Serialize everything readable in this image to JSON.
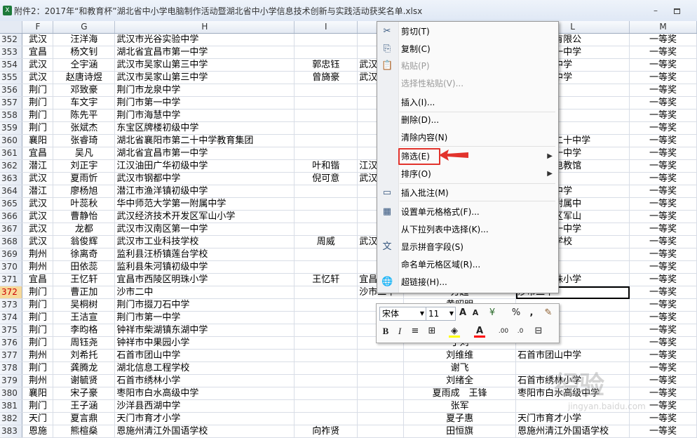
{
  "window": {
    "title": "附件2：2017年“和教育杯”湖北省中小学电脑制作活动暨湖北省中小学信息技术创新与实践活动获奖名单.xlsx",
    "app_icon": "X"
  },
  "columns": [
    "F",
    "G",
    "H",
    "I",
    "J",
    "K",
    "L",
    "M"
  ],
  "rows": [
    {
      "n": "352",
      "f": "武汉",
      "g": "汪洋海",
      "h": "武汉市光谷实验中学",
      "i": "",
      "j": "",
      "k": "",
      "l": "科技股份有限公",
      "m": "一等奖"
    },
    {
      "n": "353",
      "f": "宜昌",
      "g": "杨文钊",
      "h": "湖北省宜昌市第一中学",
      "i": "",
      "j": "",
      "k": "",
      "l": "宜昌市第一中学",
      "m": "一等奖"
    },
    {
      "n": "354",
      "f": "武汉",
      "g": "仝宇涵",
      "h": "武汉市吴家山第三中学",
      "i": "郭忠钰",
      "j": "武汉",
      "k": "",
      "l": "家山第三中学",
      "m": "一等奖"
    },
    {
      "n": "355",
      "f": "武汉",
      "g": "赵唐诗煜",
      "h": "武汉市吴家山第三中学",
      "i": "曾旖豪",
      "j": "武汉",
      "k": "",
      "l": "家山第三中学",
      "m": "一等奖"
    },
    {
      "n": "356",
      "f": "荆门",
      "g": "邓致豪",
      "h": "荆门市龙泉中学",
      "i": "",
      "j": "",
      "k": "",
      "l": "",
      "m": "一等奖"
    },
    {
      "n": "357",
      "f": "荆门",
      "g": "车文宇",
      "h": "荆门市第一中学",
      "i": "",
      "j": "",
      "k": "",
      "l": "",
      "m": "一等奖"
    },
    {
      "n": "358",
      "f": "荆门",
      "g": "陈先平",
      "h": "荆门市海慧中学",
      "i": "",
      "j": "",
      "k": "",
      "l": "",
      "m": "一等奖"
    },
    {
      "n": "359",
      "f": "荆门",
      "g": "张斌杰",
      "h": "东宝区牌楼初级中学",
      "i": "",
      "j": "",
      "k": "",
      "l": "",
      "m": "一等奖"
    },
    {
      "n": "360",
      "f": "襄阳",
      "g": "张睿琦",
      "h": "湖北省襄阳市第二十中学教育集团",
      "i": "",
      "j": "",
      "k": "",
      "l": "襄阳市第二十中学",
      "m": "一等奖"
    },
    {
      "n": "361",
      "f": "宜昌",
      "g": "吴凡",
      "h": "湖北省宜昌市第一中学",
      "i": "",
      "j": "",
      "k": "",
      "l": "宜昌市第一中学",
      "m": "一等奖"
    },
    {
      "n": "362",
      "f": "潜江",
      "g": "刘正宇",
      "h": "江汉油田广华初级中学",
      "i": "叶和锴",
      "j": "江汉",
      "k": "",
      "l": "教育集团电教馆",
      "m": "一等奖"
    },
    {
      "n": "363",
      "f": "武汉",
      "g": "夏雨忻",
      "h": "武汉市钢都中学",
      "i": "倪可意",
      "j": "武汉",
      "k": "",
      "l": "钢都中学",
      "m": "一等奖"
    },
    {
      "n": "364",
      "f": "潜江",
      "g": "廖杨旭",
      "h": "潜江市渔洋镇初级中学",
      "i": "",
      "j": "",
      "k": "",
      "l": "洋镇初级中学",
      "m": "一等奖"
    },
    {
      "n": "365",
      "f": "武汉",
      "g": "叶蕊秋",
      "h": "华中师范大学第一附属中学",
      "i": "",
      "j": "",
      "k": "",
      "l": "大学第一附属中",
      "m": "一等奖"
    },
    {
      "n": "366",
      "f": "武汉",
      "g": "曹静怡",
      "h": "武汉经济技术开发区军山小学",
      "i": "",
      "j": "",
      "k": "",
      "l": "技术开发区军山",
      "m": "一等奖"
    },
    {
      "n": "367",
      "f": "武汉",
      "g": "龙都",
      "h": "武汉市汉南区第一中学",
      "i": "",
      "j": "",
      "k": "",
      "l": "汉南区第一中学",
      "m": "一等奖"
    },
    {
      "n": "368",
      "f": "武汉",
      "g": "翁俊辉",
      "h": "武汉市工业科技学校",
      "i": "周威",
      "j": "武汉",
      "k": "",
      "l": "工业科技学校",
      "m": "一等奖"
    },
    {
      "n": "369",
      "f": "荆州",
      "g": "徐离奇",
      "h": "监利县汪桥镇莲台学校",
      "i": "",
      "j": "",
      "k": "",
      "l": "",
      "m": "一等奖"
    },
    {
      "n": "370",
      "f": "荆州",
      "g": "田依蕊",
      "h": "监利县朱河镇初级中学",
      "i": "",
      "j": "",
      "k": "",
      "l": "",
      "m": "一等奖"
    },
    {
      "n": "371",
      "f": "宜昌",
      "g": "王忆轩",
      "h": "宜昌市西陵区明珠小学",
      "i": "王忆轩",
      "j": "宜昌",
      "k": "",
      "l": "西陵区明珠小学",
      "m": "一等奖"
    },
    {
      "n": "372",
      "f": "荆门",
      "g": "曹正加",
      "h": "沙市二中",
      "i": "",
      "j": "沙市二中",
      "k": "方超",
      "l": "沙市二中",
      "m": "一等奖"
    },
    {
      "n": "373",
      "f": "荆门",
      "g": "吴桐树",
      "h": "荆门市掇刀石中学",
      "i": "",
      "j": "",
      "k": "黄昭明",
      "l": "",
      "m": "一等奖"
    },
    {
      "n": "374",
      "f": "荆门",
      "g": "王洁宣",
      "h": "荆门市第一中学",
      "i": "",
      "j": "",
      "k": "",
      "l": "",
      "m": "一等奖"
    },
    {
      "n": "375",
      "f": "荆门",
      "g": "李昀格",
      "h": "钟祥市柴湖镇东湖中学",
      "i": "",
      "j": "",
      "k": "",
      "l": "",
      "m": "一等奖"
    },
    {
      "n": "376",
      "f": "荆门",
      "g": "周钰尧",
      "h": "钟祥市中果园小学",
      "i": "",
      "j": "",
      "k": "丁刘",
      "l": "",
      "m": "一等奖"
    },
    {
      "n": "377",
      "f": "荆州",
      "g": "刘希托",
      "h": "石首市团山中学",
      "i": "",
      "j": "",
      "k": "刘维维",
      "l": "石首市团山中学",
      "m": "一等奖"
    },
    {
      "n": "378",
      "f": "荆门",
      "g": "龚腾龙",
      "h": "湖北信息工程学校",
      "i": "",
      "j": "",
      "k": "谢飞",
      "l": "",
      "m": "一等奖"
    },
    {
      "n": "379",
      "f": "荆州",
      "g": "谢毓贤",
      "h": "石首市绣林小学",
      "i": "",
      "j": "",
      "k": "刘绪全",
      "l": "石首市绣林小学",
      "m": "一等奖"
    },
    {
      "n": "380",
      "f": "襄阳",
      "g": "宋子豪",
      "h": "枣阳市白水高级中学",
      "i": "",
      "j": "",
      "k": "夏雨成　王锋",
      "l": "枣阳市白水高级中学",
      "m": "一等奖"
    },
    {
      "n": "381",
      "f": "荆门",
      "g": "王子涵",
      "h": "沙洋县西湖中学",
      "i": "",
      "j": "",
      "k": "张军",
      "l": "",
      "m": "一等奖"
    },
    {
      "n": "382",
      "f": "天门",
      "g": "夏言鼎",
      "h": "天门市育才小学",
      "i": "",
      "j": "",
      "k": "夏子惠",
      "l": "天门市育才小学",
      "m": "一等奖"
    },
    {
      "n": "383",
      "f": "恩施",
      "g": "熊楦燊",
      "h": "恩施州清江外国语学校",
      "i": "向祚贤",
      "j": "",
      "k": "田恒旗",
      "l": "恩施州清江外国语学校",
      "m": "一等奖"
    }
  ],
  "context_menu": {
    "items": [
      {
        "label": "剪切(T)",
        "icon": "scissors-icon",
        "glyph": "✂",
        "disabled": false
      },
      {
        "label": "复制(C)",
        "icon": "copy-icon",
        "glyph": "⎘",
        "disabled": false
      },
      {
        "label": "粘贴(P)",
        "icon": "paste-icon",
        "glyph": "📋",
        "disabled": true
      },
      {
        "label": "选择性粘贴(V)...",
        "icon": "",
        "glyph": "",
        "disabled": true
      },
      {
        "label": "插入(I)...",
        "icon": "",
        "glyph": "",
        "disabled": false
      },
      {
        "label": "删除(D)...",
        "icon": "",
        "glyph": "",
        "disabled": false
      },
      {
        "label": "清除内容(N)",
        "icon": "",
        "glyph": "",
        "disabled": false
      },
      {
        "label": "筛选(E)",
        "icon": "",
        "glyph": "",
        "disabled": false,
        "submenu": true
      },
      {
        "label": "排序(O)",
        "icon": "",
        "glyph": "",
        "disabled": false,
        "submenu": true
      },
      {
        "label": "插入批注(M)",
        "icon": "comment-icon",
        "glyph": "▭",
        "disabled": false
      },
      {
        "label": "设置单元格格式(F)...",
        "icon": "format-cells-icon",
        "glyph": "▦",
        "disabled": false
      },
      {
        "label": "从下拉列表中选择(K)...",
        "icon": "",
        "glyph": "",
        "disabled": false
      },
      {
        "label": "显示拼音字段(S)",
        "icon": "phonetic-icon",
        "glyph": "文",
        "disabled": false
      },
      {
        "label": "命名单元格区域(R)...",
        "icon": "",
        "glyph": "",
        "disabled": false
      },
      {
        "label": "超链接(H)...",
        "icon": "hyperlink-icon",
        "glyph": "🌐",
        "disabled": false
      }
    ]
  },
  "mini_toolbar": {
    "font_name": "宋体",
    "font_size": "11",
    "grow_font": "A",
    "shrink_font": "A",
    "currency": "¥",
    "percent": "%",
    "comma": ",",
    "bold": "B",
    "italic": "I",
    "align": "≡",
    "border": "⊞",
    "fill": "◈",
    "font_color": "A",
    "inc_decimal": ".00",
    "dec_decimal": ".0",
    "merge": "⊟",
    "fill_color": "#ffff00",
    "font_color_value": "#ff0000"
  },
  "annotation": {
    "color": "#e2332c"
  },
  "watermark": {
    "text": "经验",
    "sub": "jingyan.baidu.com"
  }
}
